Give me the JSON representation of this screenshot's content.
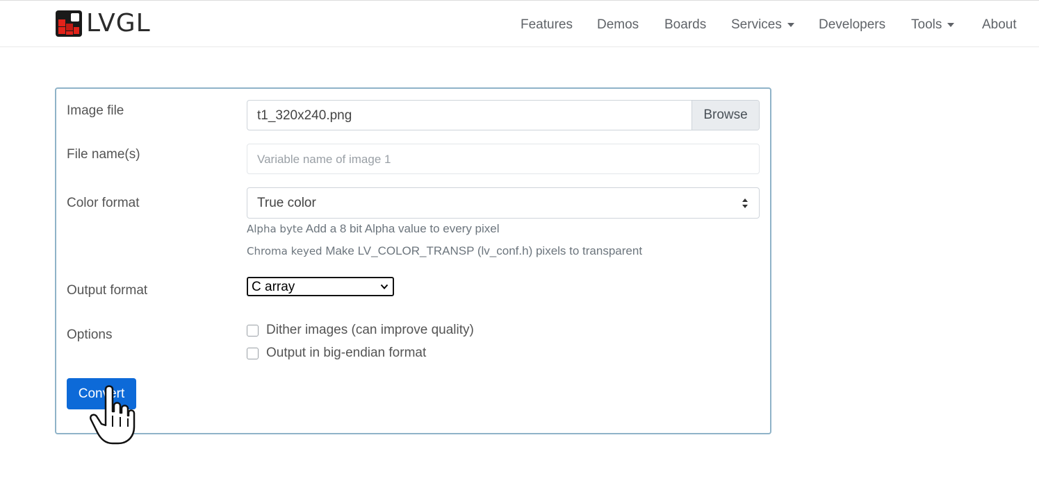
{
  "brand": {
    "name": "LVGL",
    "logo_colors": [
      "#1a1a1a",
      "#e2231a",
      "#c21b14"
    ]
  },
  "nav": {
    "items": [
      {
        "label": "Features",
        "dropdown": false
      },
      {
        "label": "Demos",
        "dropdown": false
      },
      {
        "label": "Boards",
        "dropdown": false
      },
      {
        "label": "Services",
        "dropdown": true
      },
      {
        "label": "Developers",
        "dropdown": false
      },
      {
        "label": "Tools",
        "dropdown": true
      },
      {
        "label": "About",
        "dropdown": false
      }
    ]
  },
  "form": {
    "image_file": {
      "label": "Image file",
      "value": "t1_320x240.png",
      "button": "Browse"
    },
    "file_names": {
      "label": "File name(s)",
      "placeholder": "Variable name of image 1"
    },
    "color_format": {
      "label": "Color format",
      "value": "True color",
      "help": [
        {
          "term": "Alpha byte",
          "text": "Add a 8 bit Alpha value to every pixel"
        },
        {
          "term": "Chroma keyed",
          "text": "Make LV_COLOR_TRANSP (lv_conf.h) pixels to transparent"
        }
      ]
    },
    "output_format": {
      "label": "Output format",
      "value": "C array"
    },
    "options": {
      "label": "Options",
      "items": [
        {
          "label": "Dither images (can improve quality)",
          "checked": false
        },
        {
          "label": "Output in big-endian format",
          "checked": false
        }
      ]
    },
    "submit": "Convert"
  },
  "colors": {
    "primary": "#0d6ad8",
    "card_border": "#8fb3c8",
    "nav_text": "#5f6368"
  },
  "icons": {
    "cursor": "hand-pointer-icon",
    "select_arrows": "sort-icon",
    "dropdown": "chevron-down-icon"
  }
}
